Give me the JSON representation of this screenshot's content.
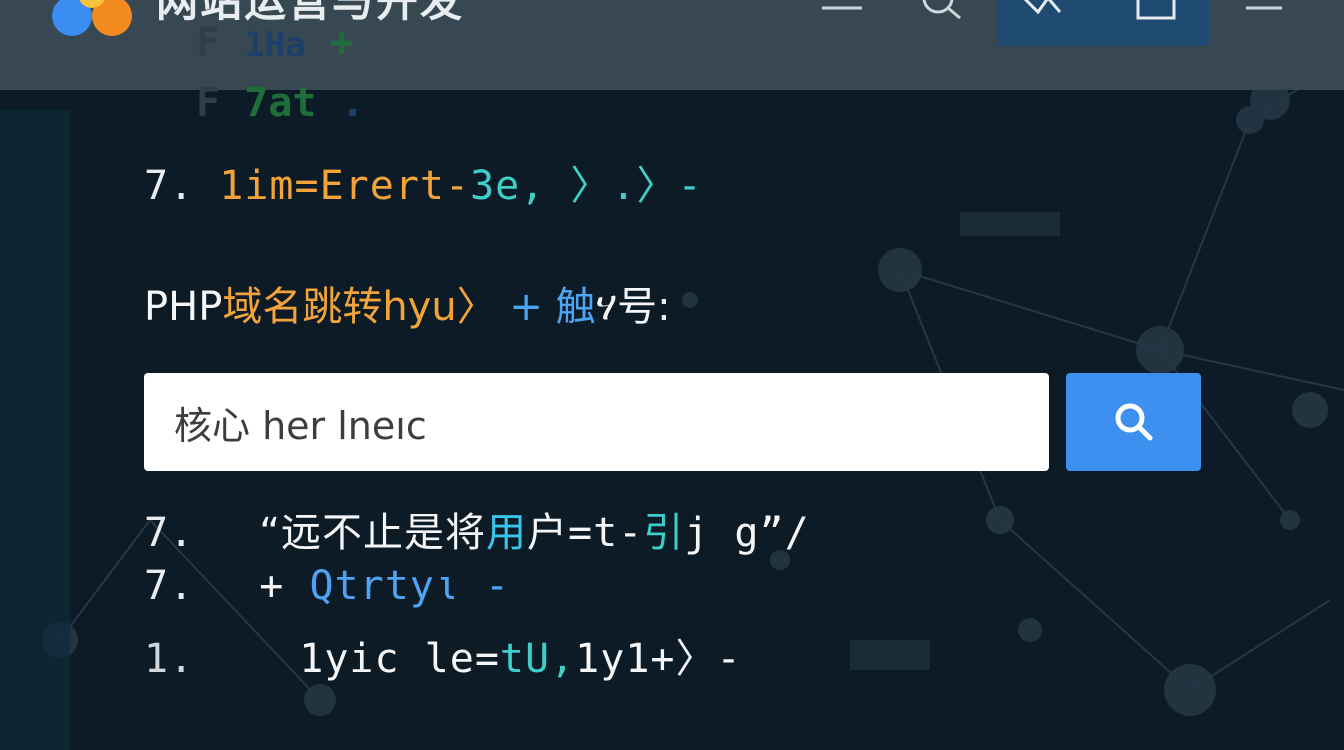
{
  "header": {
    "site_title": "网站运营与开发",
    "icons": [
      "menu-icon",
      "search-icon",
      "share-icon",
      "bookmark-icon",
      "hamburger-icon"
    ]
  },
  "ghost_rows": [
    {
      "prefix": "F",
      "text": "1Ha",
      "suffix": "+"
    },
    {
      "prefix": "F",
      "text": "7at",
      "suffix": "."
    }
  ],
  "code_line_1": {
    "num": "7.",
    "a": "1im=Erert-",
    "b": "3e,",
    "c": "〉.〉-"
  },
  "heading": {
    "prefix": "PHP",
    "cn": "域名跳转",
    "b": "hyu〉",
    "plus": "+",
    "d": "触",
    "e": "ሃ",
    "f": "号:"
  },
  "search": {
    "value": "核心 her lneıc",
    "button_icon": "search-icon"
  },
  "list": [
    {
      "num": "7.",
      "a": "“远不止是将",
      "b": "用",
      "c": "户=t-",
      "d": "引",
      "e": "j g”/"
    },
    {
      "num": "7.",
      "a": "+",
      "b": "Qtrtyι",
      "c": "-"
    },
    {
      "num": "1.",
      "a": "1yic le=",
      "b": "tU,",
      "c": "1y1+〉-"
    }
  ],
  "colors": {
    "background": "#0d1b27",
    "accent_blue": "#3d8ff0",
    "orange": "#f2a33a",
    "teal": "#3ed0c8"
  }
}
